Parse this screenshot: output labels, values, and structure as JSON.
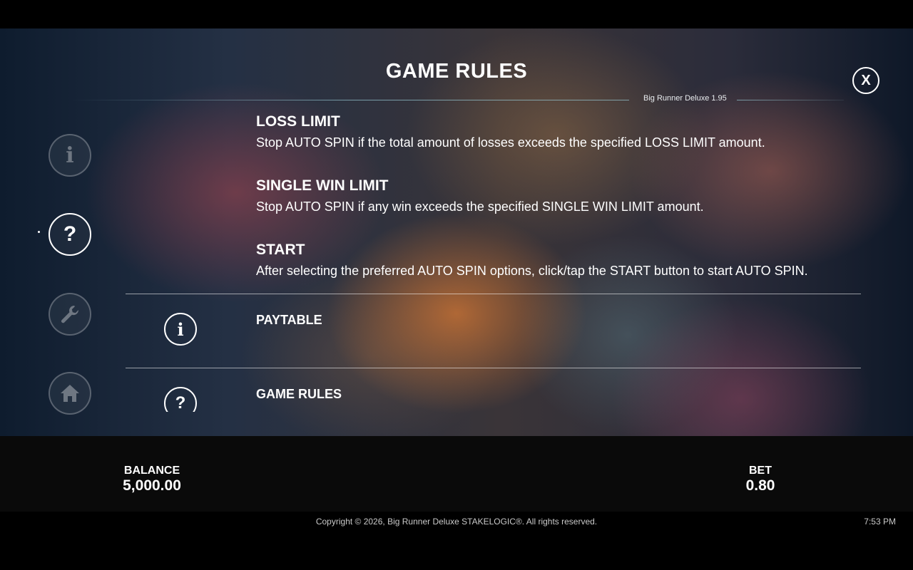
{
  "header": {
    "title": "GAME RULES",
    "version": "Big Runner Deluxe 1.95",
    "close_label": "X"
  },
  "sidebar": {
    "items": [
      {
        "name": "info",
        "glyph": "i"
      },
      {
        "name": "help",
        "glyph": "?"
      },
      {
        "name": "settings",
        "glyph": "wrench-icon"
      },
      {
        "name": "home",
        "glyph": "home-icon"
      }
    ]
  },
  "sections": [
    {
      "heading": "LOSS LIMIT",
      "text": "Stop AUTO SPIN if the total amount of losses exceeds the specified LOSS LIMIT amount."
    },
    {
      "heading": "SINGLE WIN LIMIT",
      "text": "Stop AUTO SPIN if any win exceeds the specified SINGLE WIN LIMIT amount."
    },
    {
      "heading": "START",
      "text": "After selecting the preferred AUTO SPIN options, click/tap the START button to start AUTO SPIN."
    }
  ],
  "menu": [
    {
      "label": "PAYTABLE",
      "glyph": "i"
    },
    {
      "label": "GAME RULES",
      "glyph": "?"
    }
  ],
  "status": {
    "balance_label": "BALANCE",
    "balance_value": "5,000.00",
    "bet_label": "BET",
    "bet_value": "0.80"
  },
  "footer": {
    "copyright": "Copyright © 2026, Big Runner Deluxe STAKELOGIC®. All rights reserved.",
    "time": "7:53 PM"
  }
}
